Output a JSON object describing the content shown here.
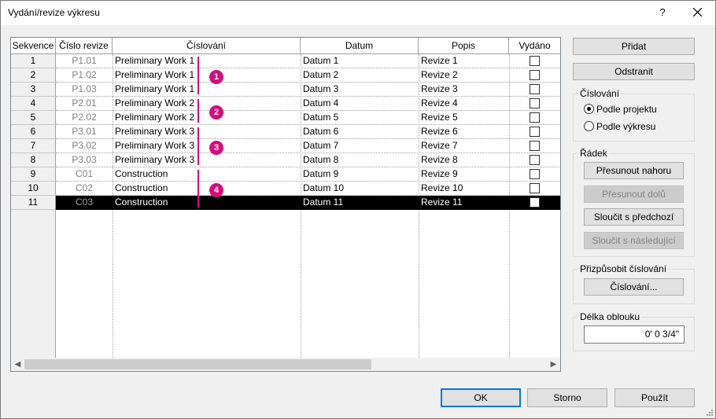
{
  "window": {
    "title": "Vydání/revize výkresu",
    "help_label": "?",
    "close_icon": "close-icon"
  },
  "table": {
    "columns": [
      "Sekvence",
      "Číslo revize",
      "Číslování",
      "Datum",
      "Popis",
      "Vydáno"
    ],
    "rows": [
      {
        "seq": "1",
        "rev": "P1.01",
        "numbering": "Preliminary Work 1",
        "date": "Datum 1",
        "desc": "Revize 1",
        "issued": false
      },
      {
        "seq": "2",
        "rev": "P1.02",
        "numbering": "Preliminary Work 1",
        "date": "Datum 2",
        "desc": "Revize 2",
        "issued": false
      },
      {
        "seq": "3",
        "rev": "P1.03",
        "numbering": "Preliminary Work 1",
        "date": "Datum 3",
        "desc": "Revize 3",
        "issued": false
      },
      {
        "seq": "4",
        "rev": "P2.01",
        "numbering": "Preliminary Work 2",
        "date": "Datum 4",
        "desc": "Revize 4",
        "issued": false
      },
      {
        "seq": "5",
        "rev": "P2.02",
        "numbering": "Preliminary Work 2",
        "date": "Datum 5",
        "desc": "Revize 5",
        "issued": false
      },
      {
        "seq": "6",
        "rev": "P3.01",
        "numbering": "Preliminary Work 3",
        "date": "Datum 6",
        "desc": "Revize 6",
        "issued": false
      },
      {
        "seq": "7",
        "rev": "P3.02",
        "numbering": "Preliminary Work 3",
        "date": "Datum 7",
        "desc": "Revize 7",
        "issued": false
      },
      {
        "seq": "8",
        "rev": "P3.03",
        "numbering": "Preliminary Work 3",
        "date": "Datum 8",
        "desc": "Revize 8",
        "issued": false
      },
      {
        "seq": "9",
        "rev": "C01",
        "numbering": "Construction",
        "date": "Datum 9",
        "desc": "Revize 9",
        "issued": false
      },
      {
        "seq": "10",
        "rev": "C02",
        "numbering": "Construction",
        "date": "Datum 10",
        "desc": "Revize 10",
        "issued": false
      },
      {
        "seq": "11",
        "rev": "C03",
        "numbering": "Construction",
        "date": "Datum 11",
        "desc": "Revize 11",
        "issued": false
      }
    ],
    "selected_row": "11"
  },
  "callouts": [
    "1",
    "2",
    "3",
    "4"
  ],
  "buttons": {
    "add": "Přidat",
    "remove": "Odstranit"
  },
  "numbering_group": {
    "label": "Číslování",
    "options": [
      "Podle projektu",
      "Podle výkresu"
    ],
    "selected": "Podle projektu"
  },
  "row_group": {
    "label": "Řádek",
    "move_up": "Přesunout nahoru",
    "move_down": "Přesunout dolů",
    "merge_prev": "Sloučit s předchozí",
    "merge_next": "Sloučit s následující"
  },
  "custom_group": {
    "label": "Přizpůsobit číslování",
    "button": "Číslování..."
  },
  "arc_group": {
    "label": "Délka oblouku",
    "value": "0'  0 3/4\""
  },
  "footer": {
    "ok": "OK",
    "cancel": "Storno",
    "apply": "Použít"
  },
  "colors": {
    "accent": "#d40f7d",
    "focus": "#0078d7",
    "selection": "#000000"
  }
}
